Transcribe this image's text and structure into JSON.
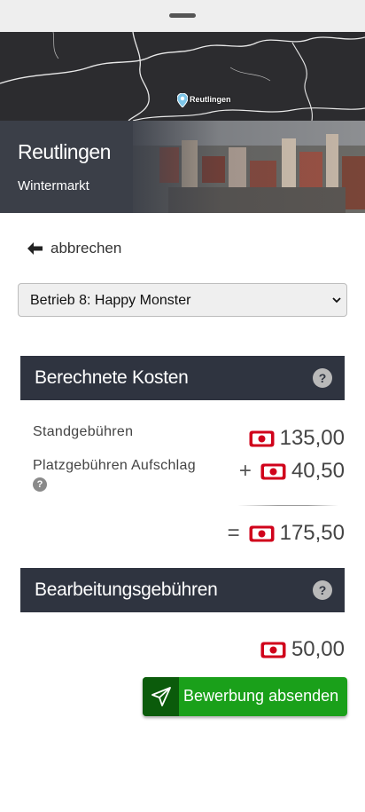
{
  "map": {
    "label": "Reutlingen"
  },
  "hero": {
    "title": "Reutlingen",
    "subtitle": "Wintermarkt"
  },
  "nav": {
    "back_label": "abbrechen"
  },
  "business_select": {
    "selected": "Betrieb 8: Happy Monster"
  },
  "costs": {
    "title": "Berechnete Kosten",
    "stand_label": "Standgebühren",
    "stand_amount": "135,00",
    "surcharge_label": "Platzgebühren Aufschlag",
    "surcharge_prefix": "+",
    "surcharge_amount": "40,50",
    "total_prefix": "=",
    "total_amount": "175,50"
  },
  "processing": {
    "title": "Bearbeitungsgebühren",
    "amount": "50,00"
  },
  "submit": {
    "label": "Bewerbung absenden"
  },
  "help_glyph": "?",
  "colors": {
    "header_bg": "#2f3440",
    "accent_green": "#1aa01a",
    "money_red": "#d0021b"
  }
}
